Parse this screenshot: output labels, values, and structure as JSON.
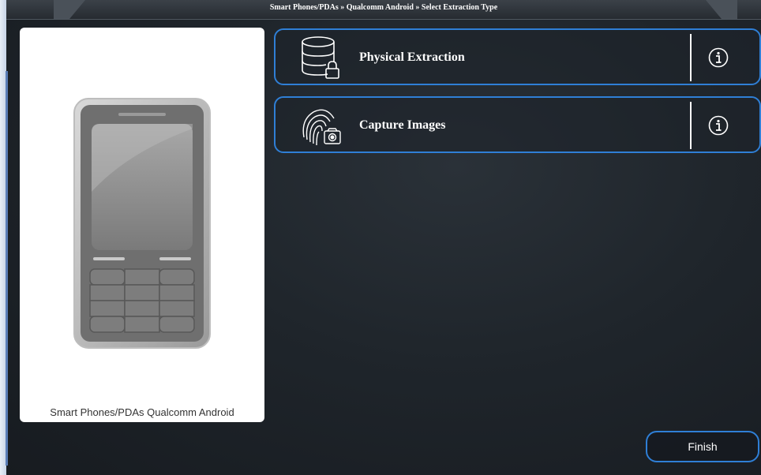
{
  "titlebar": {
    "breadcrumb": "Smart Phones/PDAs » Qualcomm  Android » Select Extraction Type"
  },
  "device_panel": {
    "caption": "Smart Phones/PDAs Qualcomm  Android",
    "image_icon": "mobile-phone-icon"
  },
  "options": [
    {
      "label": "Physical Extraction",
      "icon": "database-lock-icon",
      "info_icon": "info-icon"
    },
    {
      "label": "Capture Images",
      "icon": "fingerprint-camera-icon",
      "info_icon": "info-icon"
    }
  ],
  "footer": {
    "finish_label": "Finish"
  },
  "colors": {
    "accent_border": "#2f7fd6",
    "background": "#1f252b",
    "text": "#ffffff"
  }
}
